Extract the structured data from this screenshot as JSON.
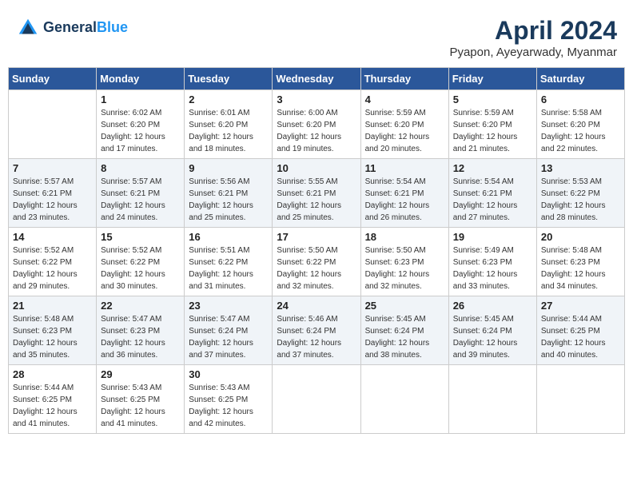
{
  "header": {
    "logo_line1": "General",
    "logo_line2": "Blue",
    "month_title": "April 2024",
    "subtitle": "Pyapon, Ayeyarwady, Myanmar"
  },
  "weekdays": [
    "Sunday",
    "Monday",
    "Tuesday",
    "Wednesday",
    "Thursday",
    "Friday",
    "Saturday"
  ],
  "weeks": [
    [
      {
        "day": "",
        "info": ""
      },
      {
        "day": "1",
        "info": "Sunrise: 6:02 AM\nSunset: 6:20 PM\nDaylight: 12 hours\nand 17 minutes."
      },
      {
        "day": "2",
        "info": "Sunrise: 6:01 AM\nSunset: 6:20 PM\nDaylight: 12 hours\nand 18 minutes."
      },
      {
        "day": "3",
        "info": "Sunrise: 6:00 AM\nSunset: 6:20 PM\nDaylight: 12 hours\nand 19 minutes."
      },
      {
        "day": "4",
        "info": "Sunrise: 5:59 AM\nSunset: 6:20 PM\nDaylight: 12 hours\nand 20 minutes."
      },
      {
        "day": "5",
        "info": "Sunrise: 5:59 AM\nSunset: 6:20 PM\nDaylight: 12 hours\nand 21 minutes."
      },
      {
        "day": "6",
        "info": "Sunrise: 5:58 AM\nSunset: 6:20 PM\nDaylight: 12 hours\nand 22 minutes."
      }
    ],
    [
      {
        "day": "7",
        "info": "Sunrise: 5:57 AM\nSunset: 6:21 PM\nDaylight: 12 hours\nand 23 minutes."
      },
      {
        "day": "8",
        "info": "Sunrise: 5:57 AM\nSunset: 6:21 PM\nDaylight: 12 hours\nand 24 minutes."
      },
      {
        "day": "9",
        "info": "Sunrise: 5:56 AM\nSunset: 6:21 PM\nDaylight: 12 hours\nand 25 minutes."
      },
      {
        "day": "10",
        "info": "Sunrise: 5:55 AM\nSunset: 6:21 PM\nDaylight: 12 hours\nand 25 minutes."
      },
      {
        "day": "11",
        "info": "Sunrise: 5:54 AM\nSunset: 6:21 PM\nDaylight: 12 hours\nand 26 minutes."
      },
      {
        "day": "12",
        "info": "Sunrise: 5:54 AM\nSunset: 6:21 PM\nDaylight: 12 hours\nand 27 minutes."
      },
      {
        "day": "13",
        "info": "Sunrise: 5:53 AM\nSunset: 6:22 PM\nDaylight: 12 hours\nand 28 minutes."
      }
    ],
    [
      {
        "day": "14",
        "info": "Sunrise: 5:52 AM\nSunset: 6:22 PM\nDaylight: 12 hours\nand 29 minutes."
      },
      {
        "day": "15",
        "info": "Sunrise: 5:52 AM\nSunset: 6:22 PM\nDaylight: 12 hours\nand 30 minutes."
      },
      {
        "day": "16",
        "info": "Sunrise: 5:51 AM\nSunset: 6:22 PM\nDaylight: 12 hours\nand 31 minutes."
      },
      {
        "day": "17",
        "info": "Sunrise: 5:50 AM\nSunset: 6:22 PM\nDaylight: 12 hours\nand 32 minutes."
      },
      {
        "day": "18",
        "info": "Sunrise: 5:50 AM\nSunset: 6:23 PM\nDaylight: 12 hours\nand 32 minutes."
      },
      {
        "day": "19",
        "info": "Sunrise: 5:49 AM\nSunset: 6:23 PM\nDaylight: 12 hours\nand 33 minutes."
      },
      {
        "day": "20",
        "info": "Sunrise: 5:48 AM\nSunset: 6:23 PM\nDaylight: 12 hours\nand 34 minutes."
      }
    ],
    [
      {
        "day": "21",
        "info": "Sunrise: 5:48 AM\nSunset: 6:23 PM\nDaylight: 12 hours\nand 35 minutes."
      },
      {
        "day": "22",
        "info": "Sunrise: 5:47 AM\nSunset: 6:23 PM\nDaylight: 12 hours\nand 36 minutes."
      },
      {
        "day": "23",
        "info": "Sunrise: 5:47 AM\nSunset: 6:24 PM\nDaylight: 12 hours\nand 37 minutes."
      },
      {
        "day": "24",
        "info": "Sunrise: 5:46 AM\nSunset: 6:24 PM\nDaylight: 12 hours\nand 37 minutes."
      },
      {
        "day": "25",
        "info": "Sunrise: 5:45 AM\nSunset: 6:24 PM\nDaylight: 12 hours\nand 38 minutes."
      },
      {
        "day": "26",
        "info": "Sunrise: 5:45 AM\nSunset: 6:24 PM\nDaylight: 12 hours\nand 39 minutes."
      },
      {
        "day": "27",
        "info": "Sunrise: 5:44 AM\nSunset: 6:25 PM\nDaylight: 12 hours\nand 40 minutes."
      }
    ],
    [
      {
        "day": "28",
        "info": "Sunrise: 5:44 AM\nSunset: 6:25 PM\nDaylight: 12 hours\nand 41 minutes."
      },
      {
        "day": "29",
        "info": "Sunrise: 5:43 AM\nSunset: 6:25 PM\nDaylight: 12 hours\nand 41 minutes."
      },
      {
        "day": "30",
        "info": "Sunrise: 5:43 AM\nSunset: 6:25 PM\nDaylight: 12 hours\nand 42 minutes."
      },
      {
        "day": "",
        "info": ""
      },
      {
        "day": "",
        "info": ""
      },
      {
        "day": "",
        "info": ""
      },
      {
        "day": "",
        "info": ""
      }
    ]
  ]
}
